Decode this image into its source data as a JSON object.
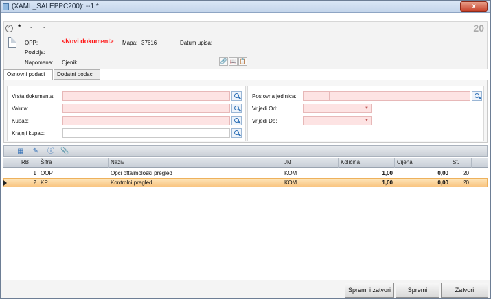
{
  "window": {
    "title": "(XAML_SALEPPC200): --1 *",
    "close_label": "x"
  },
  "header": {
    "collapse_glyph": "^",
    "star": "*",
    "dash1": "-",
    "dash2": "-",
    "number": "20",
    "opp_label": "OPP:",
    "opp_value": "<Novi dokument>",
    "mapa_label": "Mapa:",
    "mapa_value": "37616",
    "datum_label": "Datum upisa:",
    "pozicija_label": "Pozicija:",
    "napomena_label": "Napomena:",
    "napomena_value": "Cjenik"
  },
  "tabs": [
    {
      "label": "Osnovni podaci",
      "active": true
    },
    {
      "label": "Dodatni podaci",
      "active": false
    }
  ],
  "form": {
    "left": [
      {
        "label": "Vrsta dokumenta:",
        "required": true
      },
      {
        "label": "Valuta:",
        "required": true
      },
      {
        "label": "Kupac:",
        "required": true
      },
      {
        "label": "Krajnji kupac:",
        "required": false
      }
    ],
    "right": [
      {
        "label": "Poslovna jedinica:",
        "type": "lookup"
      },
      {
        "label": "Vrijedi Od:",
        "type": "date"
      },
      {
        "label": "Vrijedi Do:",
        "type": "date"
      }
    ]
  },
  "toolbar_icons": [
    "grid-settings-icon",
    "edit-icon",
    "info-icon",
    "attachment-icon"
  ],
  "grid": {
    "columns": [
      "RB",
      "Šifra",
      "Naziv",
      "JM",
      "Količina",
      "Cijena",
      "St."
    ],
    "rows": [
      {
        "rb": "1",
        "sifra": "OOP",
        "naziv": "Opći oftalmološki pregled",
        "jm": "KOM",
        "kolicina": "1,00",
        "cijena": "0,00",
        "st": "20",
        "selected": false
      },
      {
        "rb": "2",
        "sifra": "KP",
        "naziv": "Kontrolni pregled",
        "jm": "KOM",
        "kolicina": "1,00",
        "cijena": "0,00",
        "st": "20",
        "selected": true
      }
    ]
  },
  "buttons": {
    "save_close": "Spremi i zatvori",
    "save": "Spremi",
    "close": "Zatvori"
  },
  "colors": {
    "required_field": "#fde3e3",
    "selected_row": "#f9c582",
    "doc_status": "#ff1a1a"
  }
}
